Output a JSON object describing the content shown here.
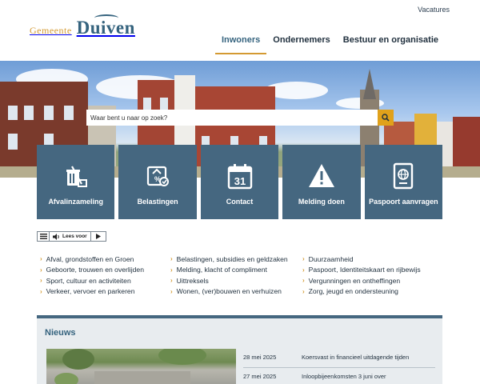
{
  "header": {
    "top_link": "Vacatures",
    "logo_small": "Gemeente",
    "logo_large": "Duiven",
    "nav": [
      "Inwoners",
      "Ondernemers",
      "Bestuur en organisatie"
    ]
  },
  "search": {
    "placeholder": "Waar bent u naar op zoek?"
  },
  "tiles": [
    {
      "label": "Afvalinzameling",
      "icon": "trash-bin-icon"
    },
    {
      "label": "Belastingen",
      "icon": "tax-document-icon"
    },
    {
      "label": "Contact",
      "icon": "calendar-31-icon",
      "icon_text": "31"
    },
    {
      "label": "Melding doen",
      "icon": "warning-icon"
    },
    {
      "label": "Paspoort aanvragen",
      "icon": "passport-icon"
    }
  ],
  "readspeaker": {
    "label": "Lees voor"
  },
  "links": {
    "col1": [
      "Afval, grondstoffen en Groen",
      "Geboorte, trouwen en overlijden",
      "Sport, cultuur en activiteiten",
      "Verkeer, vervoer en parkeren"
    ],
    "col2": [
      "Belastingen, subsidies en geldzaken",
      "Melding, klacht of compliment",
      "Uittreksels",
      "Wonen, (ver)bouwen en verhuizen"
    ],
    "col3": [
      "Duurzaamheid",
      "Paspoort, Identiteitskaart en rijbewijs",
      "Vergunningen en ontheffingen",
      "Zorg, jeugd en ondersteuning"
    ]
  },
  "news": {
    "title": "Nieuws",
    "items": [
      {
        "date": "28 mei 2025",
        "text": "Koersvast in financieel uitdagende tijden"
      },
      {
        "date": "27 mei 2025",
        "text": "Inloopbijeenkomsten 3 juni over"
      }
    ]
  },
  "colors": {
    "brand_blue": "#35637e",
    "tile_blue": "#456780",
    "accent_gold": "#d49a32",
    "search_orange": "#e0a11b"
  }
}
